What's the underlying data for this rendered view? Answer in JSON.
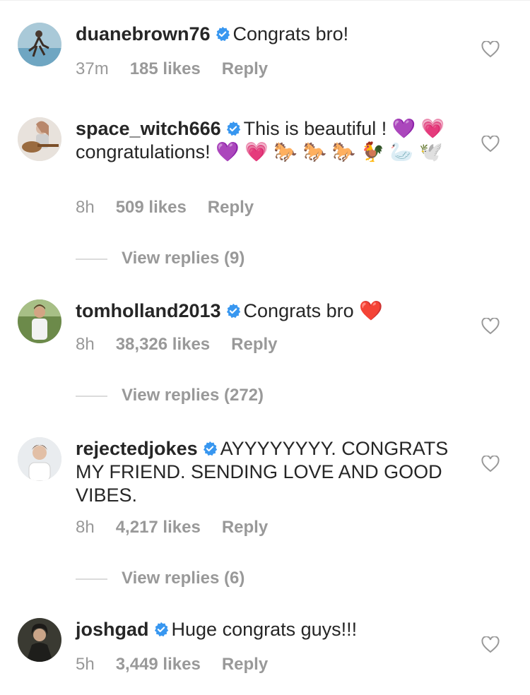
{
  "comments": [
    {
      "username": "duanebrown76",
      "text": "Congrats bro!",
      "time": "37m",
      "likes": "185 likes",
      "reply": "Reply",
      "verified": true
    },
    {
      "username": "space_witch666",
      "text": "This is beautiful ! 💜 💗 congratulations! 💜 💗 🐎 🐎 🐎 🐓 🦢 🕊️",
      "time": "8h",
      "likes": "509 likes",
      "reply": "Reply",
      "verified": true,
      "view_replies": "View replies (9)"
    },
    {
      "username": "tomholland2013",
      "text": "Congrats bro ❤️",
      "time": "8h",
      "likes": "38,326 likes",
      "reply": "Reply",
      "verified": true,
      "view_replies": "View replies (272)"
    },
    {
      "username": "rejectedjokes",
      "text": "AYYYYYYYY. CONGRATS MY FRIEND. SENDING LOVE AND GOOD VIBES.",
      "time": "8h",
      "likes": "4,217 likes",
      "reply": "Reply",
      "verified": true,
      "view_replies": "View replies (6)"
    },
    {
      "username": "joshgad",
      "text": "Huge congrats guys!!!",
      "time": "5h",
      "likes": "3,449 likes",
      "reply": "Reply",
      "verified": true
    }
  ],
  "colors": {
    "username": "#262626",
    "meta": "#999999",
    "verified": "#3897f0",
    "divider": "#dbdbdb"
  },
  "icons": {
    "like": "heart-outline-icon",
    "verified": "verified-badge-icon"
  }
}
